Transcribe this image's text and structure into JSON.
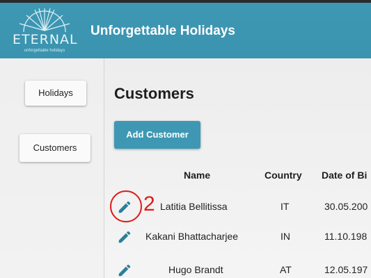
{
  "header": {
    "logo_word": "ETERNAL",
    "logo_tagline": "unforgettable holidays",
    "title": "Unforgettable Holidays"
  },
  "sidebar": {
    "items": [
      {
        "label": "Holidays"
      },
      {
        "label": "Customers"
      }
    ]
  },
  "main": {
    "page_title": "Customers",
    "add_button_label": "Add Customer",
    "table": {
      "columns": [
        "Name",
        "Country",
        "Date of Bi"
      ],
      "rows": [
        {
          "name": "Latitia Bellitissa",
          "country": "IT",
          "dob": "30.05.200"
        },
        {
          "name": "Kakani Bhattacharjee",
          "country": "IN",
          "dob": "11.10.198"
        },
        {
          "name": "Hugo Brandt",
          "country": "AT",
          "dob": "12.05.197"
        }
      ]
    }
  },
  "annotation": {
    "number": "2",
    "color": "#e21b1b"
  },
  "colors": {
    "accent": "#3e98b4"
  },
  "icons": {
    "row_action": "pencil-edit-icon"
  }
}
